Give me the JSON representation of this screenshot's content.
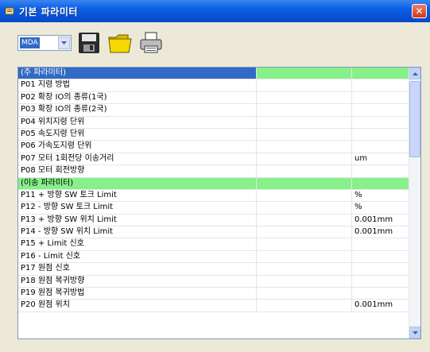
{
  "window": {
    "title": "기본 파라미터",
    "close_glyph": "✕"
  },
  "toolbar": {
    "mode_value": "MDA"
  },
  "grid": {
    "rows": [
      {
        "kind": "header",
        "name": "(주 파라미터)",
        "value": "",
        "unit": ""
      },
      {
        "kind": "normal",
        "name": "P01 지령 방법",
        "value": "",
        "unit": ""
      },
      {
        "kind": "normal",
        "name": "P02 확장 IO의 종류(1국)",
        "value": "",
        "unit": ""
      },
      {
        "kind": "normal",
        "name": "P03 확장 IO의 종류(2국)",
        "value": "",
        "unit": ""
      },
      {
        "kind": "normal",
        "name": "P04 위치지령 단위",
        "value": "",
        "unit": ""
      },
      {
        "kind": "normal",
        "name": "P05 속도지령 단위",
        "value": "",
        "unit": ""
      },
      {
        "kind": "normal",
        "name": "P06 가속도지령 단위",
        "value": "",
        "unit": ""
      },
      {
        "kind": "normal",
        "name": "P07 모터 1회전당 이송거리",
        "value": "",
        "unit": "um"
      },
      {
        "kind": "normal",
        "name": "P08 모터 회전방향",
        "value": "",
        "unit": ""
      },
      {
        "kind": "section",
        "name": "(이송 파라미터)",
        "value": "",
        "unit": ""
      },
      {
        "kind": "normal",
        "name": "P11 + 방향 SW 토크 Limit",
        "value": "",
        "unit": "%"
      },
      {
        "kind": "normal",
        "name": "P12 - 방향 SW 토크 Limit",
        "value": "",
        "unit": "%"
      },
      {
        "kind": "normal",
        "name": "P13 + 방향 SW 위치 Limit",
        "value": "",
        "unit": "0.001mm"
      },
      {
        "kind": "normal",
        "name": "P14 - 방향 SW 위치 Limit",
        "value": "",
        "unit": "0.001mm"
      },
      {
        "kind": "normal",
        "name": "P15 + Limit 신호",
        "value": "",
        "unit": ""
      },
      {
        "kind": "normal",
        "name": "P16 - Limit 신호",
        "value": "",
        "unit": ""
      },
      {
        "kind": "normal",
        "name": "P17 원점 신호",
        "value": "",
        "unit": ""
      },
      {
        "kind": "normal",
        "name": "P18 원점 복귀방향",
        "value": "",
        "unit": ""
      },
      {
        "kind": "normal",
        "name": "P19 원점 복귀방법",
        "value": "",
        "unit": ""
      },
      {
        "kind": "normal",
        "name": "P20 원점 위치",
        "value": "",
        "unit": "0.001mm"
      }
    ]
  },
  "colors": {
    "header_selected": "#316ac5",
    "section_green": "#88f08a",
    "titlebar": "#0a5fe3"
  }
}
